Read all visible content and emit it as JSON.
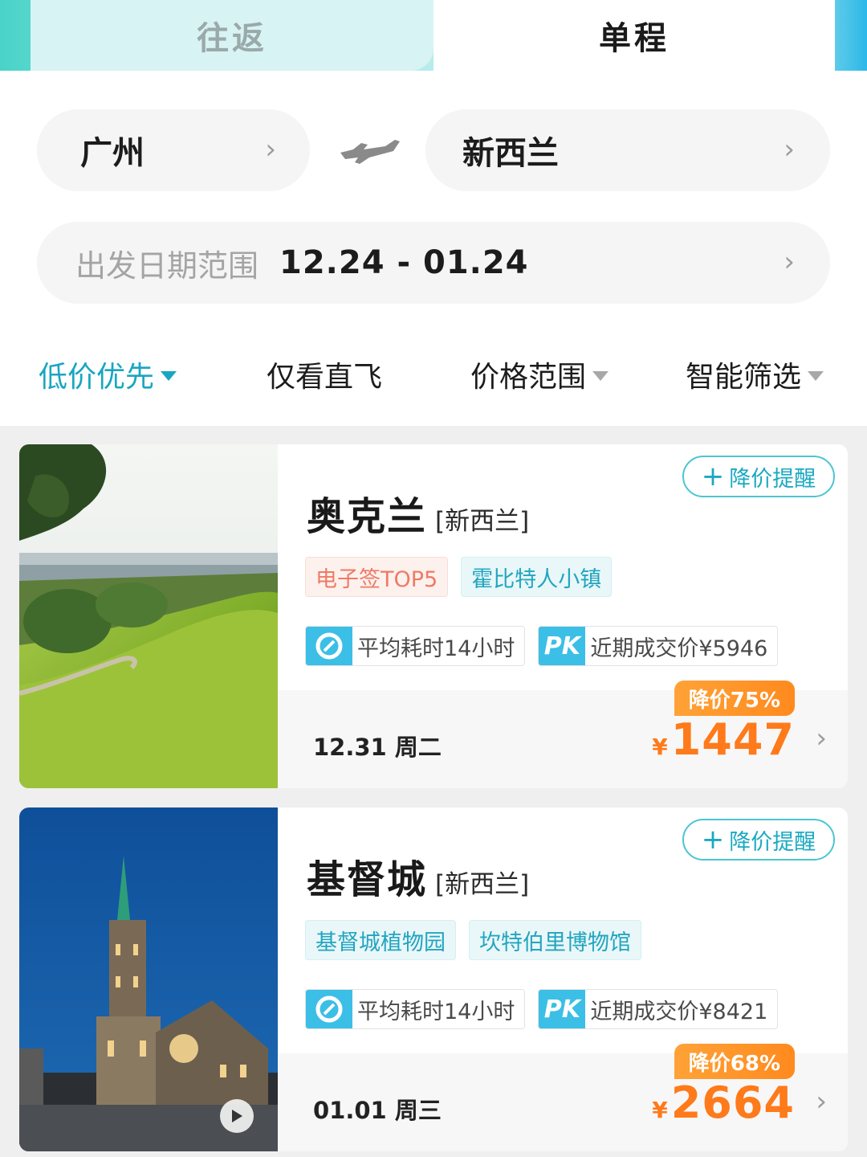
{
  "tabs": {
    "round_trip": "往返",
    "one_way": "单程"
  },
  "route": {
    "from": "广州",
    "to": "新西兰"
  },
  "date_filter": {
    "label": "出发日期范围",
    "range": "12.24 - 01.24"
  },
  "filters": [
    {
      "label": "低价优先",
      "active": true
    },
    {
      "label": "仅看直飞",
      "active": false
    },
    {
      "label": "价格范围",
      "active": false
    },
    {
      "label": "智能筛选",
      "active": false
    }
  ],
  "cards": [
    {
      "city": "奥克兰",
      "country": "[新西兰]",
      "alert_label": "降价提醒",
      "tags": [
        {
          "text": "电子签TOP5",
          "style": "red"
        },
        {
          "text": "霍比特人小镇",
          "style": "blue"
        }
      ],
      "avg_time": "平均耗时14小时",
      "pk_label": "PK",
      "recent_price": "近期成交价¥5946",
      "date": "12.31 周二",
      "discount": "降价75%",
      "currency": "¥",
      "price": "1447"
    },
    {
      "city": "基督城",
      "country": "[新西兰]",
      "alert_label": "降价提醒",
      "tags": [
        {
          "text": "基督城植物园",
          "style": "blue"
        },
        {
          "text": "坎特伯里博物馆",
          "style": "blue"
        }
      ],
      "avg_time": "平均耗时14小时",
      "pk_label": "PK",
      "recent_price": "近期成交价¥8421",
      "date": "01.01 周三",
      "discount": "降价68%",
      "currency": "¥",
      "price": "2664"
    }
  ],
  "colors": {
    "accent": "#19a6c2",
    "price": "#ff7a1a",
    "tag_red": "#ef7a64"
  }
}
